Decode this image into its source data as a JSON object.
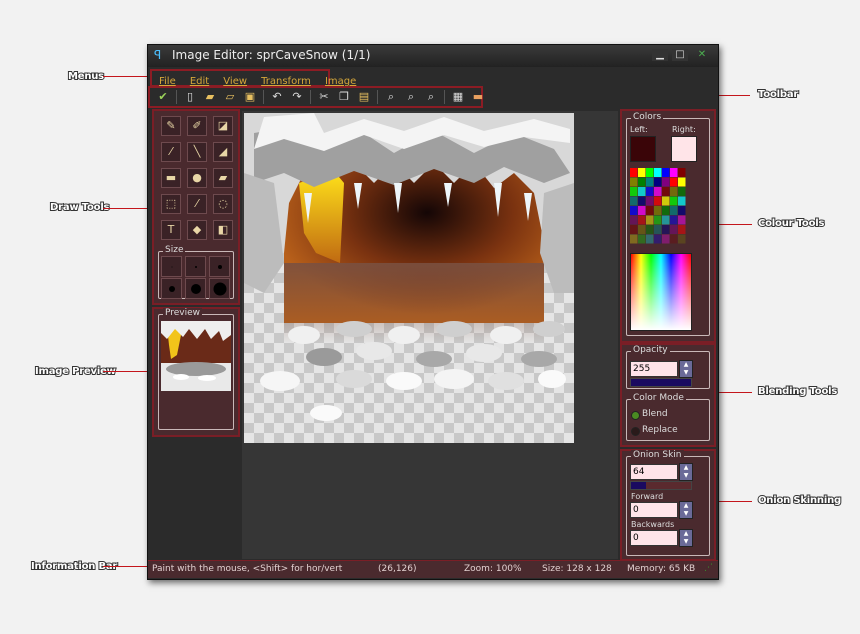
{
  "annotations": {
    "menus": "Menus",
    "toolbar": "Toolbar",
    "draw_tools": "Draw Tools",
    "colour_tools": "Colour Tools",
    "image_preview": "Image Preview",
    "blending_tools": "Blending Tools",
    "onion_skinning": "Onion Skinning",
    "information_bar": "Information Bar"
  },
  "window": {
    "title": "Image Editor: sprCaveSnow (1/1)"
  },
  "menu": [
    "File",
    "Edit",
    "View",
    "Transform",
    "Image"
  ],
  "draw_tools": {
    "size_label": "Size"
  },
  "preview": {
    "label": "Preview"
  },
  "colors": {
    "label": "Colors",
    "left_label": "Left:",
    "right_label": "Right:",
    "left_color": "#3a0508",
    "right_color": "#ffe4e8"
  },
  "opacity": {
    "label": "Opacity",
    "value": "255"
  },
  "color_mode": {
    "label": "Color Mode",
    "blend": "Blend",
    "replace": "Replace"
  },
  "onion": {
    "label": "Onion Skin",
    "value": "64",
    "forward_label": "Forward",
    "forward_value": "0",
    "backwards_label": "Backwards",
    "backwards_value": "0"
  },
  "status": {
    "hint": "Paint with the mouse, <Shift> for hor/vert",
    "coords": "(26,126)",
    "zoom": "Zoom: 100%",
    "size": "Size: 128 x 128",
    "memory": "Memory: 65 KB"
  }
}
